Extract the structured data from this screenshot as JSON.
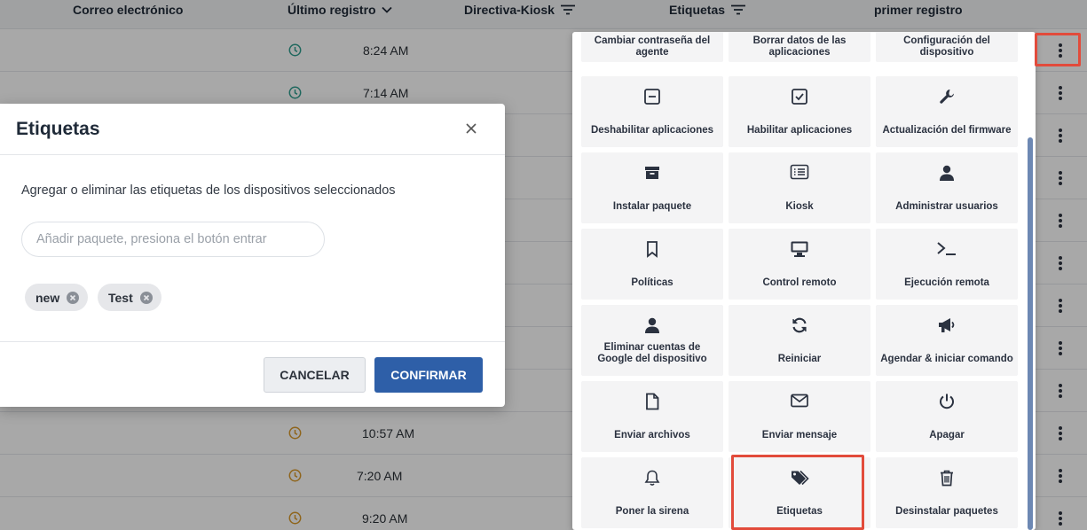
{
  "table": {
    "headers": [
      {
        "label": "Correo electrónico"
      },
      {
        "label": "Último registro"
      },
      {
        "label": "Directiva-Kiosk"
      },
      {
        "label": "Etiquetas"
      },
      {
        "label": "primer registro"
      }
    ],
    "rows": [
      {
        "time": "8:24 AM"
      },
      {
        "time": "7:14 AM"
      },
      {
        "time": ""
      },
      {
        "time": ""
      },
      {
        "time": ""
      },
      {
        "time": ""
      },
      {
        "time": ""
      },
      {
        "time": ""
      },
      {
        "time": ""
      },
      {
        "time": "10:57 AM"
      },
      {
        "time": "7:20 AM"
      },
      {
        "time": "9:20 AM"
      }
    ]
  },
  "menu": {
    "items": [
      {
        "label": "Cambiar contraseña del agente",
        "icon": "key-icon"
      },
      {
        "label": "Borrar datos de las aplicaciones",
        "icon": "eraser-icon"
      },
      {
        "label": "Configuración del dispositivo",
        "icon": "settings-icon"
      },
      {
        "label": "Deshabilitar aplicaciones",
        "icon": "minus-square-icon"
      },
      {
        "label": "Habilitar aplicaciones",
        "icon": "check-square-icon"
      },
      {
        "label": "Actualización del firmware",
        "icon": "wrench-icon"
      },
      {
        "label": "Instalar paquete",
        "icon": "archive-icon"
      },
      {
        "label": "Kiosk",
        "icon": "list-icon"
      },
      {
        "label": "Administrar usuarios",
        "icon": "user-icon"
      },
      {
        "label": "Políticas",
        "icon": "bookmark-icon"
      },
      {
        "label": "Control remoto",
        "icon": "monitor-icon"
      },
      {
        "label": "Ejecución remota",
        "icon": "terminal-icon"
      },
      {
        "label": "Eliminar cuentas de Google del dispositivo",
        "icon": "user-icon"
      },
      {
        "label": "Reiniciar",
        "icon": "refresh-icon"
      },
      {
        "label": "Agendar & iniciar comando",
        "icon": "megaphone-icon"
      },
      {
        "label": "Enviar archivos",
        "icon": "file-icon"
      },
      {
        "label": "Enviar mensaje",
        "icon": "mail-icon"
      },
      {
        "label": "Apagar",
        "icon": "power-icon"
      },
      {
        "label": "Poner la sirena",
        "icon": "bell-icon"
      },
      {
        "label": "Etiquetas",
        "icon": "tags-icon"
      },
      {
        "label": "Desinstalar paquetes",
        "icon": "trash-icon"
      }
    ]
  },
  "modal": {
    "title": "Etiquetas",
    "description": "Agregar o eliminar las etiquetas de los dispositivos seleccionados",
    "input_placeholder": "Añadir paquete, presiona el botón entrar",
    "input_value": "",
    "tags": [
      {
        "label": "new"
      },
      {
        "label": "Test"
      }
    ],
    "cancel_label": "CANCELAR",
    "confirm_label": "CONFIRMAR"
  },
  "colors": {
    "primary": "#2e5fa8",
    "highlight": "#e24b3b",
    "clock_teal": "#2f9e8f",
    "clock_orange": "#d99a2b"
  }
}
